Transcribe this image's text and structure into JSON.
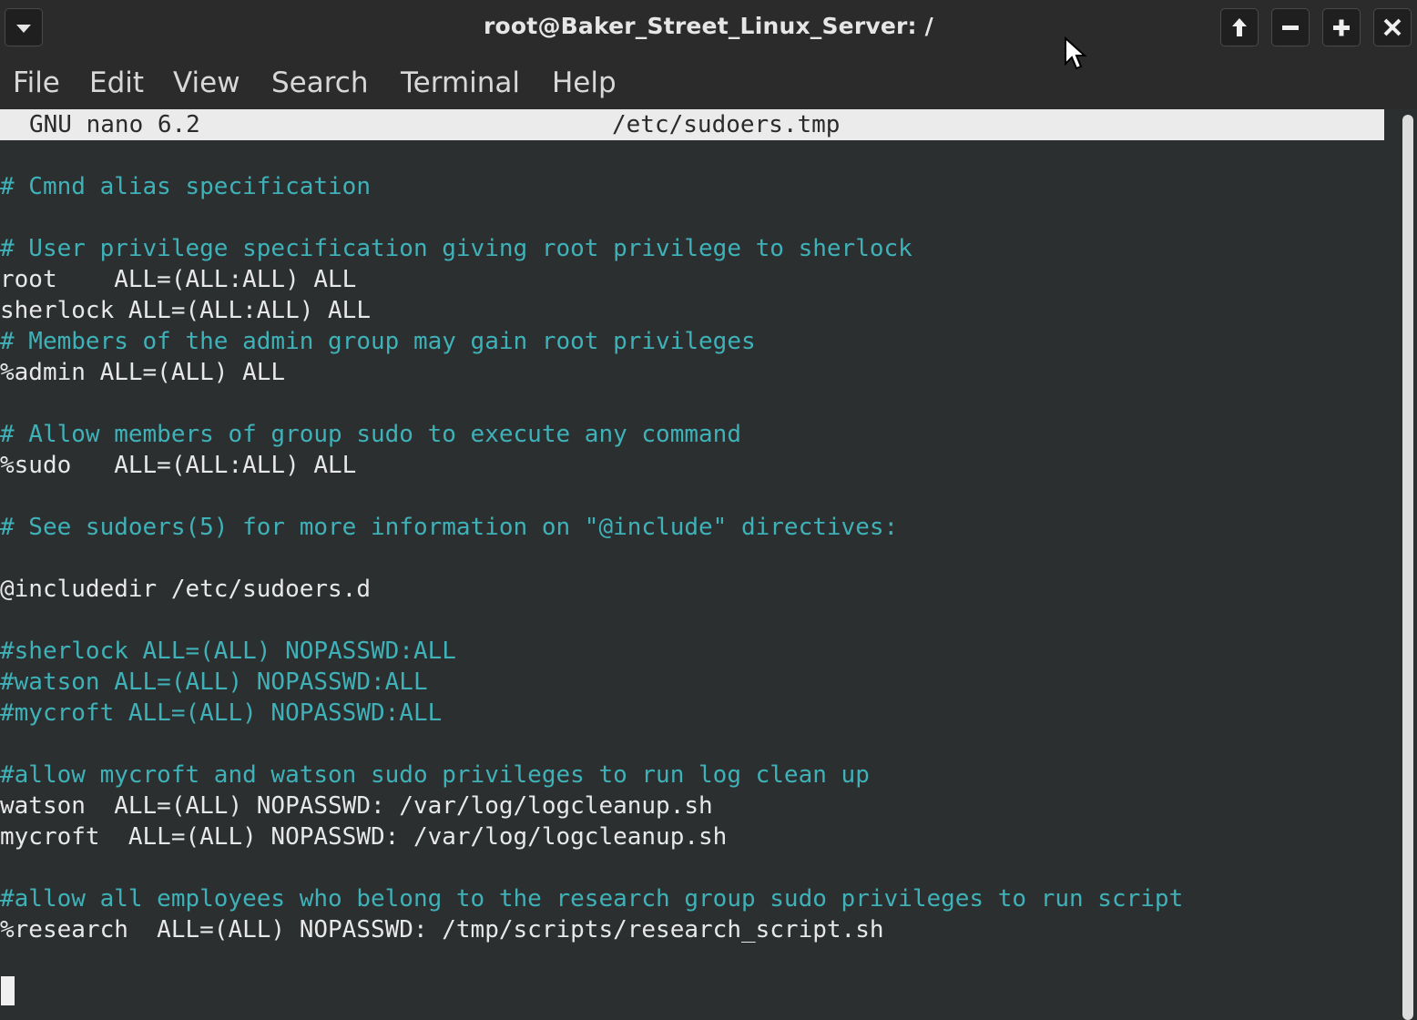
{
  "window": {
    "title": "root@Baker_Street_Linux_Server: /",
    "controls": {
      "dropdown_icon": "chevron-down-icon",
      "maximize_up_icon": "arrow-up-icon",
      "minimize_icon": "minus-icon",
      "zoom_in_icon": "plus-icon",
      "close_icon": "close-icon"
    }
  },
  "menubar": {
    "items": [
      "File",
      "Edit",
      "View",
      "Search",
      "Terminal",
      "Help"
    ]
  },
  "nano": {
    "version_label": "GNU nano 6.2",
    "filename": "/etc/sudoers.tmp"
  },
  "colors": {
    "comment": "#3fb1b8",
    "text": "#e8e8e8",
    "background": "#2b2f2f",
    "header_bg": "#ebebeb"
  },
  "editor": {
    "lines": [
      {
        "text": "",
        "type": "text"
      },
      {
        "text": "# Cmnd alias specification",
        "type": "comment"
      },
      {
        "text": "",
        "type": "text"
      },
      {
        "text": "# User privilege specification giving root privilege to sherlock",
        "type": "comment"
      },
      {
        "text": "root    ALL=(ALL:ALL) ALL",
        "type": "text"
      },
      {
        "text": "sherlock ALL=(ALL:ALL) ALL",
        "type": "text"
      },
      {
        "text": "# Members of the admin group may gain root privileges",
        "type": "comment"
      },
      {
        "text": "%admin ALL=(ALL) ALL",
        "type": "text"
      },
      {
        "text": "",
        "type": "text"
      },
      {
        "text": "# Allow members of group sudo to execute any command",
        "type": "comment"
      },
      {
        "text": "%sudo   ALL=(ALL:ALL) ALL",
        "type": "text"
      },
      {
        "text": "",
        "type": "text"
      },
      {
        "text": "# See sudoers(5) for more information on \"@include\" directives:",
        "type": "comment"
      },
      {
        "text": "",
        "type": "text"
      },
      {
        "text": "@includedir /etc/sudoers.d",
        "type": "text"
      },
      {
        "text": "",
        "type": "text"
      },
      {
        "text": "#sherlock ALL=(ALL) NOPASSWD:ALL",
        "type": "comment"
      },
      {
        "text": "#watson ALL=(ALL) NOPASSWD:ALL",
        "type": "comment"
      },
      {
        "text": "#mycroft ALL=(ALL) NOPASSWD:ALL",
        "type": "comment"
      },
      {
        "text": "",
        "type": "text"
      },
      {
        "text": "#allow mycroft and watson sudo privileges to run log clean up",
        "type": "comment"
      },
      {
        "text": "watson  ALL=(ALL) NOPASSWD: /var/log/logcleanup.sh",
        "type": "text"
      },
      {
        "text": "mycroft  ALL=(ALL) NOPASSWD: /var/log/logcleanup.sh",
        "type": "text"
      },
      {
        "text": "",
        "type": "text"
      },
      {
        "text": "#allow all employees who belong to the research group sudo privileges to run script",
        "type": "comment"
      },
      {
        "text": "%research  ALL=(ALL) NOPASSWD: /tmp/scripts/research_script.sh",
        "type": "text"
      },
      {
        "text": "",
        "type": "text"
      }
    ]
  }
}
